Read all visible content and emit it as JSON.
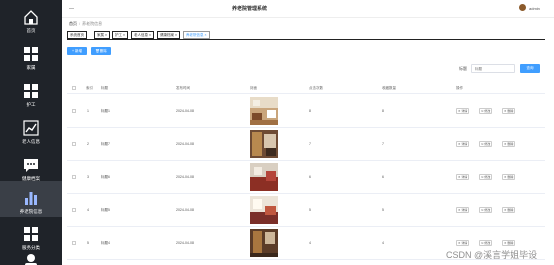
{
  "sidebar": {
    "items": [
      {
        "label": "首页",
        "icon": "home-icon"
      },
      {
        "label": "家属",
        "icon": "grid-icon"
      },
      {
        "label": "护工",
        "icon": "grid-icon"
      },
      {
        "label": "老人信息",
        "icon": "trend-icon"
      },
      {
        "label": "健康档案",
        "icon": "chat-icon"
      },
      {
        "label": "养老院信息",
        "icon": "bar-chart-icon"
      },
      {
        "label": "服务分类",
        "icon": "grid-icon"
      }
    ]
  },
  "header": {
    "dash": "—",
    "title": "养老院管理系统",
    "user": "admin"
  },
  "breadcrumb": {
    "home": "首页",
    "current": "养老院信息"
  },
  "tabs": [
    "系统首页",
    "家属 ×",
    "护工 ×",
    "老人信息 ×",
    "健康档案 ×",
    "养老院信息 ×"
  ],
  "toolbar": {
    "add_label": "+ 新增",
    "delete_label": "删除"
  },
  "search": {
    "label": "标题",
    "placeholder": "标题",
    "button": "查询"
  },
  "table": {
    "headers": [
      "索引",
      "标题",
      "发布时间",
      "封面",
      "点击次数",
      "收藏数量",
      "操作"
    ],
    "actions": [
      "详情",
      "修改",
      "删除"
    ],
    "rows": [
      {
        "index": "1",
        "title": "标题1",
        "date": "2024-04-08",
        "clicks": "8",
        "favorites": "8"
      },
      {
        "index": "2",
        "title": "标题7",
        "date": "2024-04-08",
        "clicks": "7",
        "favorites": "7"
      },
      {
        "index": "3",
        "title": "标题6",
        "date": "2024-04-08",
        "clicks": "6",
        "favorites": "6"
      },
      {
        "index": "4",
        "title": "标题5",
        "date": "2024-04-08",
        "clicks": "5",
        "favorites": "5"
      },
      {
        "index": "5",
        "title": "标题4",
        "date": "2024-04-08",
        "clicks": "4",
        "favorites": "4"
      }
    ]
  },
  "colors": {
    "sidebar_bg": "#1f2329",
    "accent": "#409eff"
  },
  "watermark": "CSDN @溪言学姐毕设"
}
